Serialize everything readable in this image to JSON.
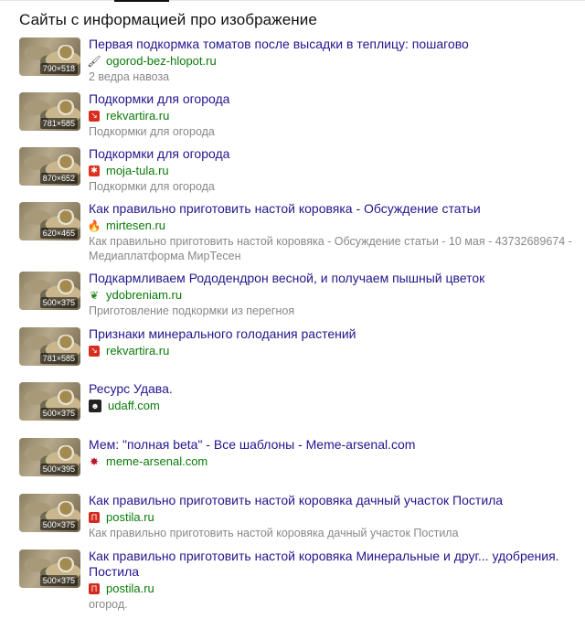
{
  "header": {
    "title": "Сайты с информацией про изображение"
  },
  "results": [
    {
      "title": "Первая подкормка томатов после высадки в теплицу: пошагово",
      "site": "ogorod-bez-hlopot.ru",
      "desc": "2 ведра навоза",
      "dims": "790×518",
      "favicon": "brush-icon"
    },
    {
      "title": "Подкормки для огорода",
      "site": "rekvartira.ru",
      "desc": "Подкормки для огорода",
      "dims": "781×585",
      "favicon": "arrow-icon"
    },
    {
      "title": "Подкормки для огорода",
      "site": "moja-tula.ru",
      "desc": "Подкормки для огорода",
      "dims": "870×652",
      "favicon": "ornament-icon"
    },
    {
      "title": "Как правильно приготовить настой коровяка - Обсуждение статьи",
      "site": "mirtesen.ru",
      "desc": "Как правильно приготовить настой коровяка - Обсуждение статьи - 10 мая - 43732689674 - Медиаплатформа МирТесен",
      "dims": "620×465",
      "favicon": "flame-icon"
    },
    {
      "title": "Подкармливаем Рододендрон весной, и получаем пышный цветок",
      "site": "ydobreniam.ru",
      "desc": "Приготовление подкормки из перегноя",
      "dims": "500×375",
      "favicon": "leaf-icon"
    },
    {
      "title": "Признаки минерального голодания растений",
      "site": "rekvartira.ru",
      "desc": "",
      "dims": "781×585",
      "favicon": "arrow-icon"
    },
    {
      "title": "Ресурс Удава.",
      "site": "udaff.com",
      "desc": "",
      "dims": "500×375",
      "favicon": "face-icon"
    },
    {
      "title": "Мем: \"полная beta\" - Все шаблоны - Meme-arsenal.com",
      "site": "meme-arsenal.com",
      "desc": "",
      "dims": "500×395",
      "favicon": "bug-icon"
    },
    {
      "title": "Как правильно приготовить настой коровяка дачный участок Постила",
      "site": "postila.ru",
      "desc": "Как правильно приготовить настой коровяка дачный участок Постила",
      "dims": "500×375",
      "favicon": "p-icon"
    },
    {
      "title": "Как правильно приготовить настой коровяка Минеральные и друг... удобрения. Постила",
      "site": "postila.ru",
      "desc": "огород.",
      "dims": "500×375",
      "favicon": "p-icon"
    }
  ]
}
